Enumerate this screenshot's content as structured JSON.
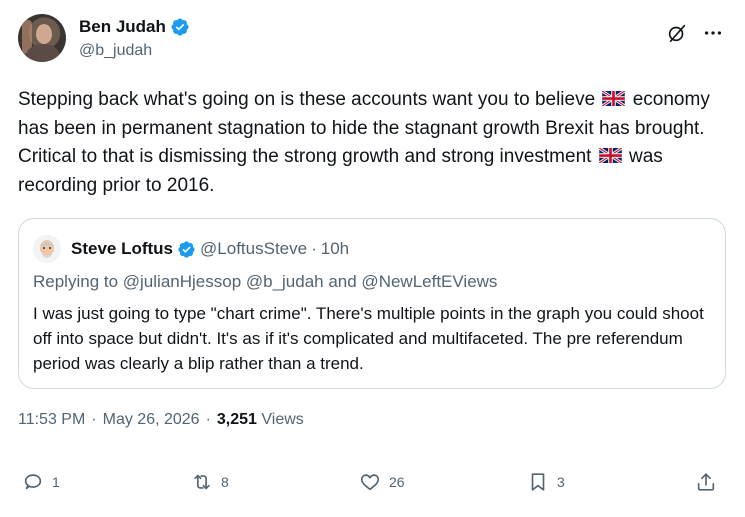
{
  "author": {
    "display_name": "Ben Judah",
    "handle": "@b_judah",
    "verified": true
  },
  "header_icons": [
    "grok-icon",
    "more-icon"
  ],
  "tweet": {
    "line1_pre": "Stepping back what's going on is these accounts want you to believe",
    "line2": "economy has been in permanent stagnation to hide the stagnant growth Brexit has brought. Critical to that is dismissing the strong growth and strong investment",
    "line3_post": "was recording prior to 2016."
  },
  "quote": {
    "display_name": "Steve Loftus",
    "handle": "@LoftusSteve",
    "separator": "·",
    "time": "10h",
    "reply_line": "Replying to @julianHjessop @b_judah and @NewLeftEViews",
    "text": "I was just going to type \"chart crime\". There's multiple points in the graph you could shoot off into space but didn't. It's as if it's complicated and multifaceted. The pre referendum period was clearly a blip rather than a trend."
  },
  "meta": {
    "time": "11:53 PM",
    "sep1": "·",
    "date": "May 26, 2026",
    "sep2": "·",
    "views_count": "3,251",
    "views_label": "Views"
  },
  "actions": {
    "replies": "1",
    "reposts": "8",
    "likes": "26",
    "bookmarks": "3"
  },
  "colors": {
    "text": "#0f1419",
    "secondary": "#536471",
    "verified": "#1d9bf0",
    "border": "#cfd9de"
  }
}
